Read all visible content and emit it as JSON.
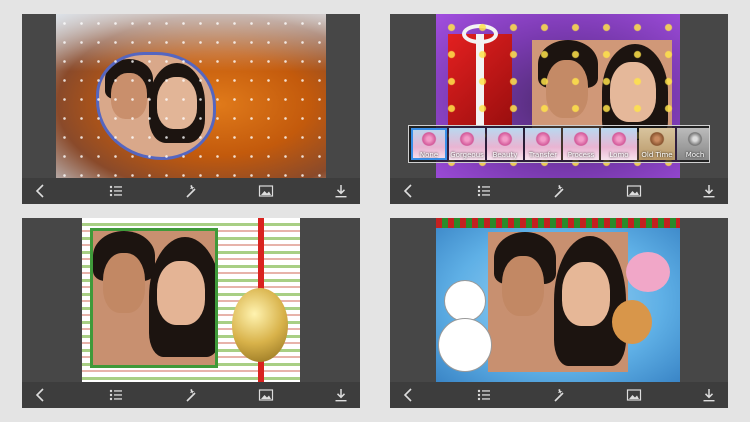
{
  "panels": [
    {
      "id": "winter-snow-frame"
    },
    {
      "id": "red-gift-star-frame"
    },
    {
      "id": "striped-ornament-frame"
    },
    {
      "id": "cartoon-snowman-frame"
    }
  ],
  "toolbar": {
    "icons": [
      "back-icon",
      "list-icon",
      "magic-wand-icon",
      "image-icon",
      "download-icon"
    ]
  },
  "filters": [
    {
      "label": "None",
      "selected": true
    },
    {
      "label": "Gorgeous",
      "selected": false
    },
    {
      "label": "Beauty",
      "selected": false
    },
    {
      "label": "Transfer",
      "selected": false
    },
    {
      "label": "Process",
      "selected": false
    },
    {
      "label": "Lomo",
      "selected": false
    },
    {
      "label": "Old Time",
      "selected": false
    },
    {
      "label": "Moch",
      "selected": false
    }
  ],
  "colors": {
    "background": "#e4e4e4",
    "panel": "#474747",
    "toolbar": "#3d3d3d",
    "selected_filter": "#3a8fe8"
  }
}
